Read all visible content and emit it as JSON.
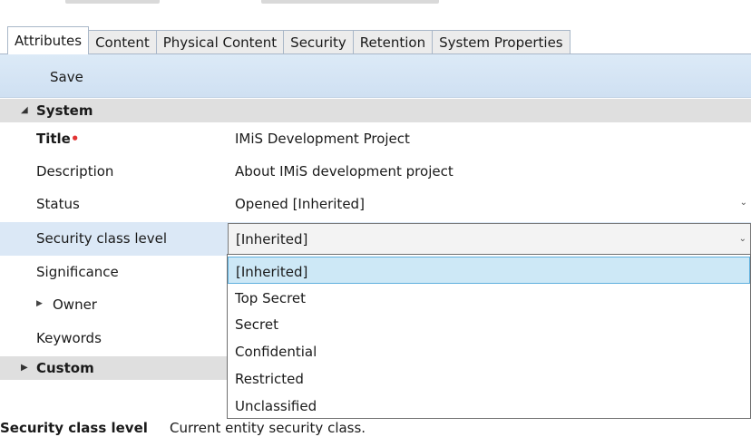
{
  "tabs": [
    {
      "label": "Attributes"
    },
    {
      "label": "Content"
    },
    {
      "label": "Physical Content"
    },
    {
      "label": "Security"
    },
    {
      "label": "Retention"
    },
    {
      "label": "System Properties"
    }
  ],
  "toolbar": {
    "save_label": "Save"
  },
  "groups": {
    "system": {
      "label": "System"
    },
    "custom": {
      "label": "Custom"
    }
  },
  "fields": {
    "title": {
      "label": "Title",
      "required_mark": "•",
      "value": "IMiS Development Project"
    },
    "description": {
      "label": "Description",
      "value": "About IMiS development project"
    },
    "status": {
      "label": "Status",
      "value": "Opened [Inherited]"
    },
    "security_class": {
      "label": "Security class level",
      "value": "[Inherited]"
    },
    "significance": {
      "label": "Significance"
    },
    "owner": {
      "label": "Owner"
    },
    "keywords": {
      "label": "Keywords"
    }
  },
  "dropdown": {
    "options": [
      "[Inherited]",
      "Top Secret",
      "Secret",
      "Confidential",
      "Restricted",
      "Unclassified"
    ],
    "selected": "[Inherited]"
  },
  "hint": {
    "term": "Security class level",
    "text": "Current entity security class."
  },
  "colors": {
    "tab_border": "#a9b7c8",
    "toolbar": "#d6e6f5",
    "group_band": "#dfdfdf",
    "highlight": "#cde8f6",
    "required": "#e23333"
  }
}
